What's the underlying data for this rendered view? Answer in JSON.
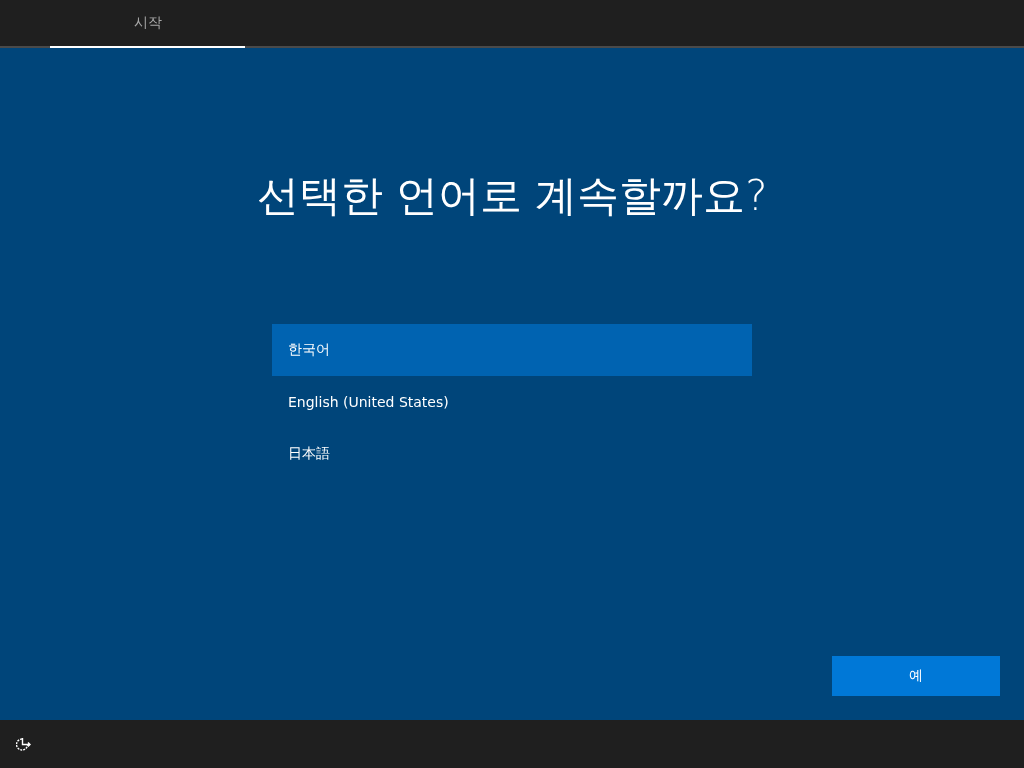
{
  "tabs": [
    {
      "label": "시작",
      "selected": true
    }
  ],
  "title": "선택한 언어로 계속할까요?",
  "languages": [
    {
      "label": "한국어",
      "selected": true
    },
    {
      "label": "English (United States)",
      "selected": false
    },
    {
      "label": "日本語",
      "selected": false
    }
  ],
  "primary_button": "예"
}
